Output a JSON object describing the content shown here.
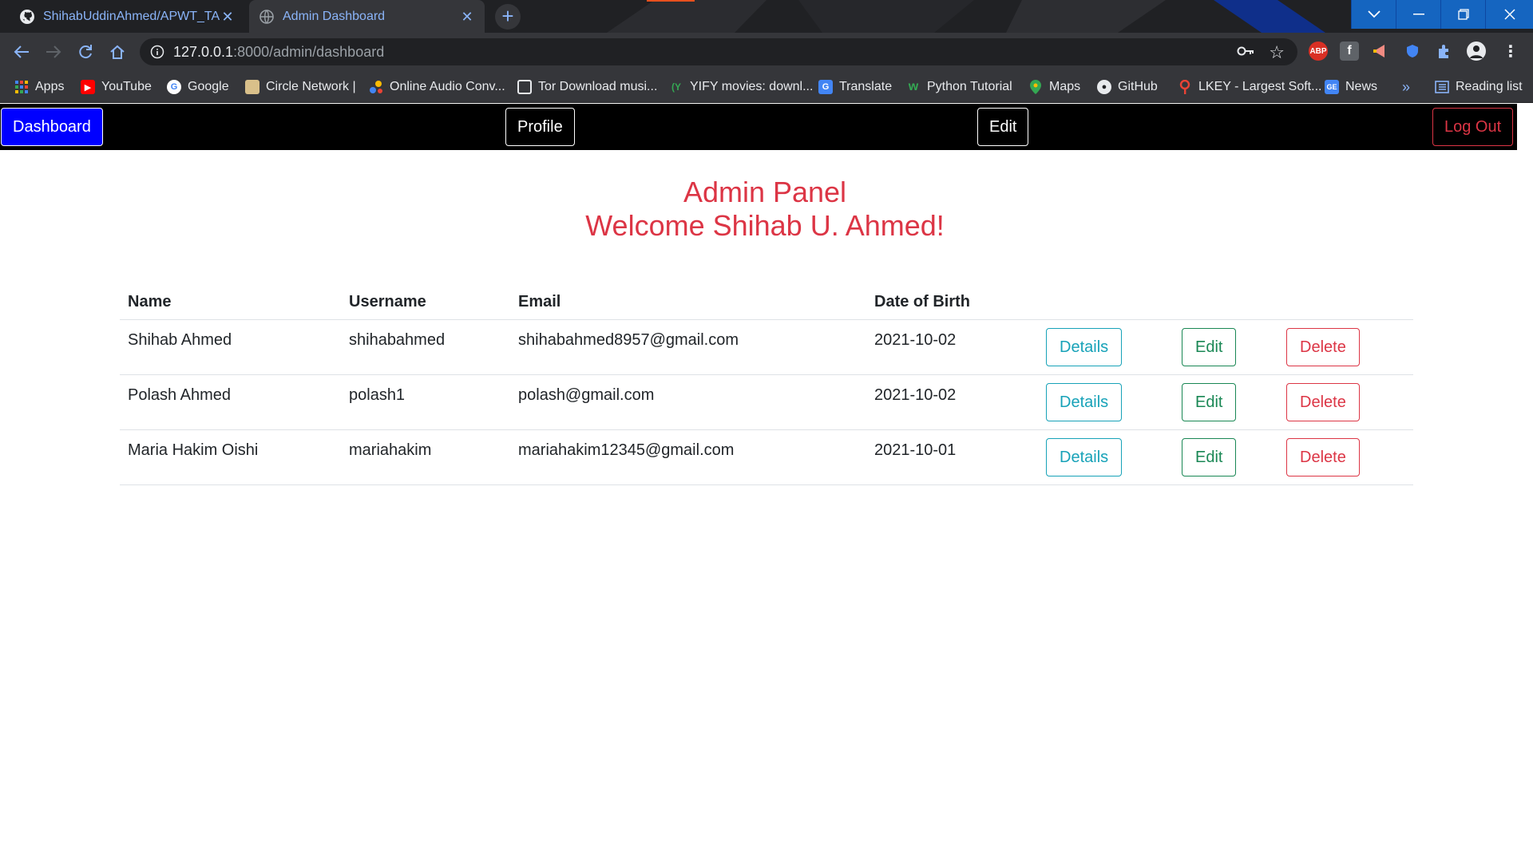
{
  "browser": {
    "tabs": [
      {
        "title": "ShihabUddinAhmed/APWT_TASK",
        "icon": "github-icon",
        "active": false
      },
      {
        "title": "Admin Dashboard",
        "icon": "globe-icon",
        "active": true
      }
    ],
    "address": {
      "host": "127.0.0.1",
      "rest": ":8000/admin/dashboard"
    },
    "bookmarks": [
      {
        "label": "Apps",
        "icon": "apps-grid-icon"
      },
      {
        "label": "YouTube",
        "icon": "youtube-icon"
      },
      {
        "label": "Google",
        "icon": "google-icon"
      },
      {
        "label": "Circle Network |",
        "icon": "circle-network-icon"
      },
      {
        "label": "Online Audio Conv...",
        "icon": "audio-converter-icon"
      },
      {
        "label": "Tor Download musi...",
        "icon": "tor-download-icon"
      },
      {
        "label": "YIFY movies: downl...",
        "icon": "yify-icon"
      },
      {
        "label": "Translate",
        "icon": "translate-icon"
      },
      {
        "label": "Python Tutorial",
        "icon": "w3schools-icon"
      },
      {
        "label": "Maps",
        "icon": "maps-pin-icon"
      },
      {
        "label": "GitHub",
        "icon": "github-icon"
      },
      {
        "label": "LKEY - Largest Soft...",
        "icon": "lkey-icon"
      },
      {
        "label": "News",
        "icon": "news-icon"
      }
    ],
    "more_bookmarks": "»",
    "reading_list": "Reading list"
  },
  "navbar": {
    "dashboard": "Dashboard",
    "profile": "Profile",
    "edit": "Edit",
    "logout": "Log Out"
  },
  "heading": {
    "line1": "Admin Panel",
    "line2": "Welcome Shihab U. Ahmed!"
  },
  "table": {
    "columns": [
      "Name",
      "Username",
      "Email",
      "Date of Birth"
    ],
    "rows": [
      {
        "name": "Shihab Ahmed",
        "username": "shihabahmed",
        "email": "shihabahmed8957@gmail.com",
        "dob": "2021-10-02"
      },
      {
        "name": "Polash Ahmed",
        "username": "polash1",
        "email": "polash@gmail.com",
        "dob": "2021-10-02"
      },
      {
        "name": "Maria Hakim Oishi",
        "username": "mariahakim",
        "email": "mariahakim12345@gmail.com",
        "dob": "2021-10-01"
      }
    ],
    "actions": {
      "details": "Details",
      "edit": "Edit",
      "delete": "Delete"
    }
  },
  "colors": {
    "accent_red": "#dc3545",
    "details_cyan": "#17a2b8",
    "edit_green": "#198754",
    "dashboard_blue": "#0000ff",
    "chrome_dark": "#202124",
    "chrome_toolbar": "#35363a",
    "tab_text": "#8ab4f8"
  }
}
